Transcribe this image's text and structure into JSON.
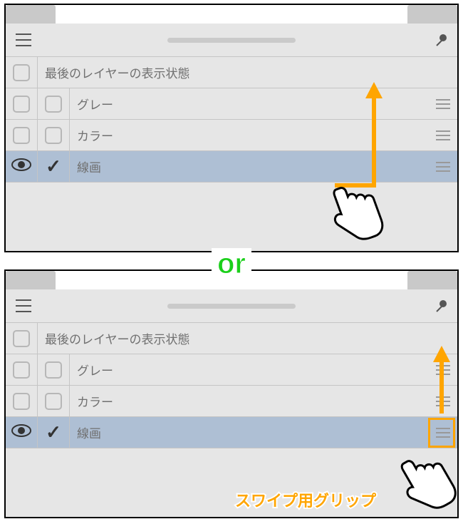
{
  "or_text": "or",
  "annotation_label": "スワイプ用グリップ",
  "panelA": {
    "header_label": "最後のレイヤーの表示状態",
    "rows": [
      {
        "label": "グレー",
        "visible": false,
        "checked": false,
        "selected": false
      },
      {
        "label": "カラー",
        "visible": false,
        "checked": false,
        "selected": false
      },
      {
        "label": "線画",
        "visible": true,
        "checked": true,
        "selected": true
      }
    ]
  },
  "panelB": {
    "header_label": "最後のレイヤーの表示状態",
    "rows": [
      {
        "label": "グレー",
        "visible": false,
        "checked": false,
        "selected": false
      },
      {
        "label": "カラー",
        "visible": false,
        "checked": false,
        "selected": false
      },
      {
        "label": "線画",
        "visible": true,
        "checked": true,
        "selected": true
      }
    ]
  }
}
